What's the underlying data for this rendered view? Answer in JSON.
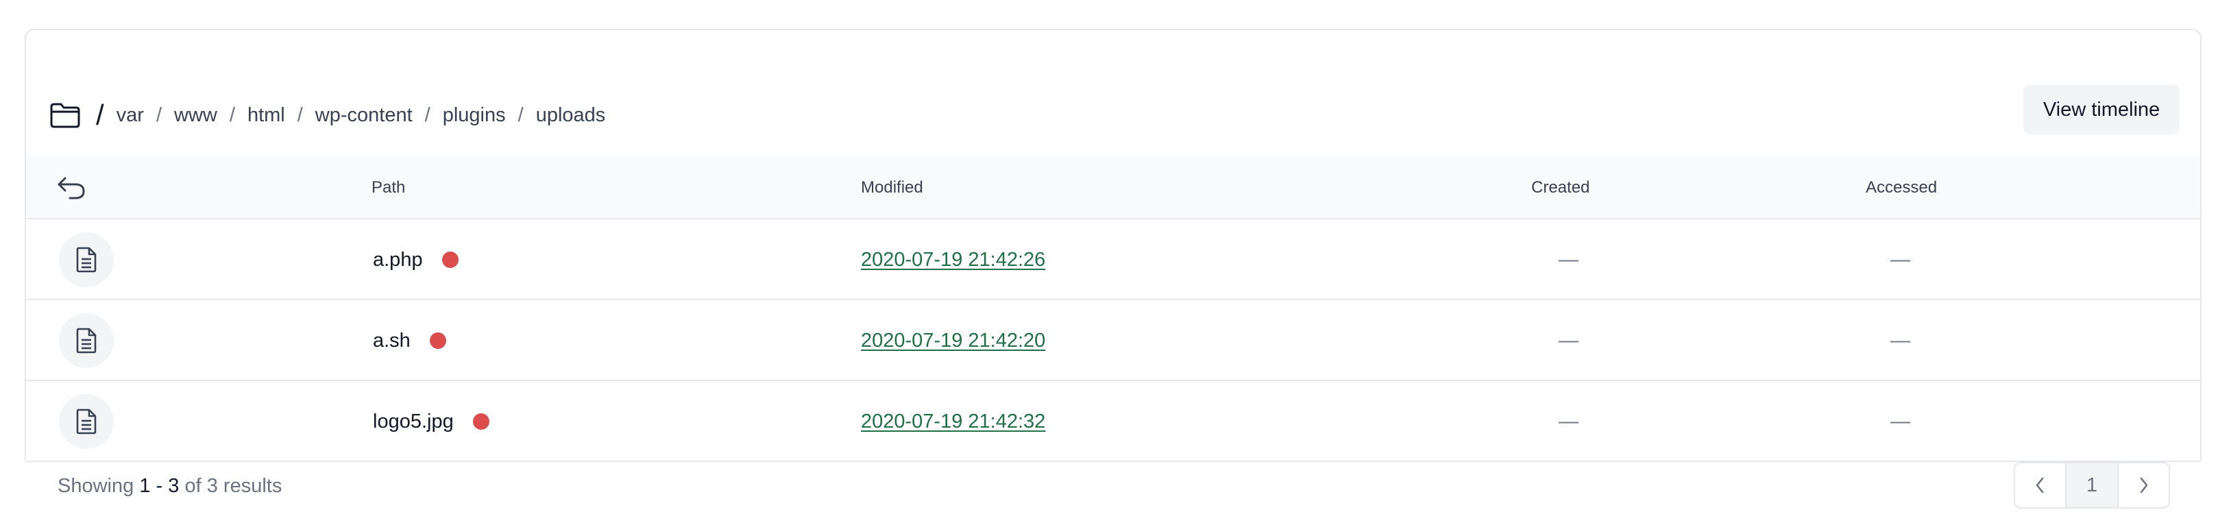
{
  "breadcrumb": {
    "root": "/",
    "separator": "/",
    "items": [
      "var",
      "www",
      "html",
      "wp-content",
      "plugins",
      "uploads"
    ]
  },
  "actions": {
    "view_timeline": "View timeline"
  },
  "table": {
    "headers": {
      "path": "Path",
      "modified": "Modified",
      "created": "Created",
      "accessed": "Accessed"
    },
    "rows": [
      {
        "path": "a.php",
        "modified": "2020-07-19 21:42:26",
        "created": "—",
        "accessed": "—",
        "flag_color": "#dc4c4c"
      },
      {
        "path": "a.sh",
        "modified": "2020-07-19 21:42:20",
        "created": "—",
        "accessed": "—",
        "flag_color": "#dc4c4c"
      },
      {
        "path": "logo5.jpg",
        "modified": "2020-07-19 21:42:32",
        "created": "—",
        "accessed": "—",
        "flag_color": "#dc4c4c"
      }
    ]
  },
  "footer": {
    "showing_prefix": "Showing",
    "range_start": "1",
    "range_dash": "-",
    "range_end": "3",
    "of_label": "of",
    "total": "3",
    "results_label": "results"
  },
  "pagination": {
    "current_page": "1"
  },
  "icons": {
    "breadcrumb": "folder-icon",
    "back": "undo-arrow-icon",
    "file": "document-icon",
    "prev": "chevron-left-icon",
    "next": "chevron-right-icon"
  },
  "colors": {
    "link_green": "#1f6f47",
    "flag_red": "#dc4c4c",
    "header_bg": "#f9fafb",
    "border": "#e5e7eb"
  }
}
